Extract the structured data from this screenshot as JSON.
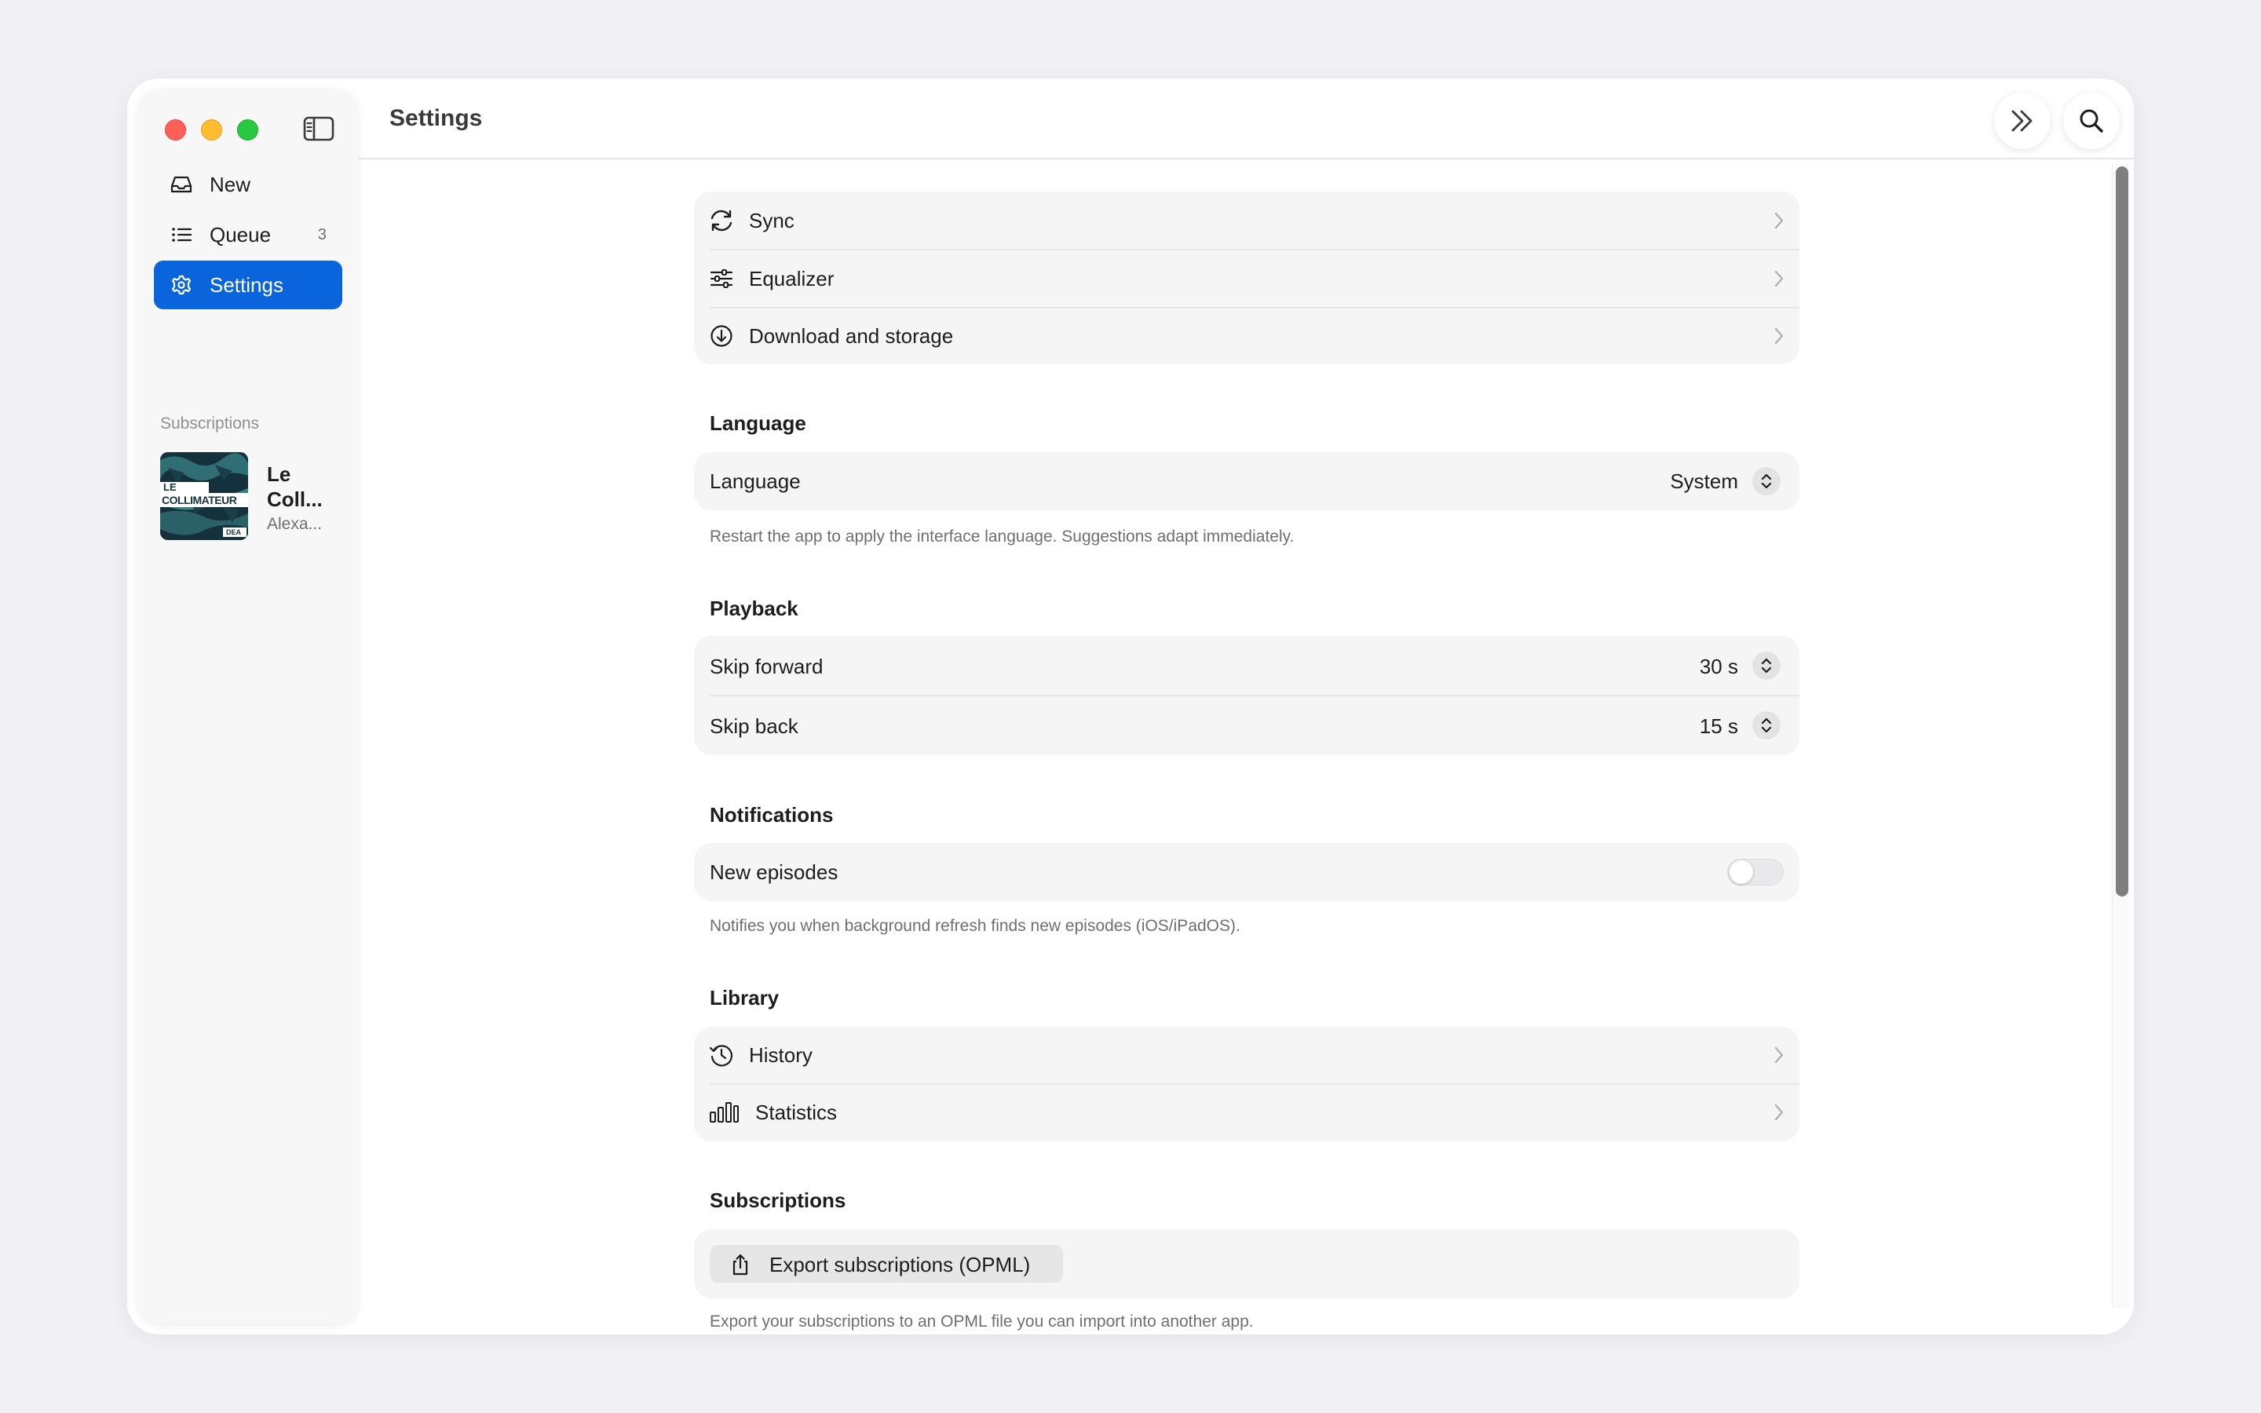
{
  "window": {
    "title": "Settings"
  },
  "sidebar": {
    "items": [
      {
        "label": "New",
        "icon": "inbox-icon"
      },
      {
        "label": "Queue",
        "icon": "list-icon",
        "count": "3"
      },
      {
        "label": "Settings",
        "icon": "gear-icon",
        "active": true
      }
    ],
    "subscriptions_label": "Subscriptions",
    "subscriptions": [
      {
        "title": "Le Coll...",
        "author": "Alexa...",
        "artwork_text_top": "LE",
        "artwork_text_main": "COLLIMATEUR",
        "artwork_badge": "DEA"
      }
    ]
  },
  "header": {
    "skip_icon": "chevrons-right-icon",
    "search_icon": "search-icon"
  },
  "settings": {
    "general": [
      {
        "label": "Sync",
        "icon": "sync-icon"
      },
      {
        "label": "Equalizer",
        "icon": "sliders-icon"
      },
      {
        "label": "Download and storage",
        "icon": "download-icon"
      }
    ],
    "language": {
      "heading": "Language",
      "row_label": "Language",
      "value": "System",
      "footnote": "Restart the app to apply the interface language. Suggestions adapt immediately."
    },
    "playback": {
      "heading": "Playback",
      "rows": [
        {
          "label": "Skip forward",
          "value": "30 s"
        },
        {
          "label": "Skip back",
          "value": "15 s"
        }
      ]
    },
    "notifications": {
      "heading": "Notifications",
      "row_label": "New episodes",
      "enabled": false,
      "footnote": "Notifies you when background refresh finds new episodes (iOS/iPadOS)."
    },
    "library": {
      "heading": "Library",
      "rows": [
        {
          "label": "History",
          "icon": "history-icon"
        },
        {
          "label": "Statistics",
          "icon": "bar-chart-icon"
        }
      ]
    },
    "subscriptions": {
      "heading": "Subscriptions",
      "export_label": "Export subscriptions (OPML)",
      "export_icon": "share-icon",
      "footnote": "Export your subscriptions to an OPML file you can import into another app."
    }
  },
  "colors": {
    "accent": "#0a64dc",
    "background": "#f0f0f5",
    "card": "#f5f5f5"
  }
}
